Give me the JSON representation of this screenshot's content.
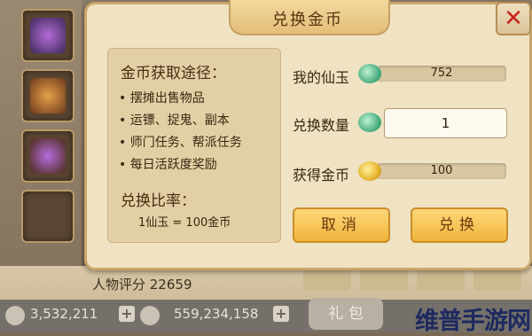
{
  "dialog": {
    "title": "兑换金币",
    "close_icon": "close-x-icon",
    "info": {
      "heading": "金币获取途径：",
      "ways": [
        "• 摆摊出售物品",
        "• 运镖、捉鬼、副本",
        "• 师门任务、帮派任务",
        "• 每日活跃度奖励"
      ],
      "rate_heading": "兑换比率：",
      "rate_value": "1仙玉  =  100金币"
    },
    "my_jade": {
      "label": "我的仙玉",
      "value": "752",
      "icon": "jade-icon"
    },
    "exchange_qty": {
      "label": "兑换数量",
      "value": "1",
      "icon": "jade-icon"
    },
    "gain_gold": {
      "label": "获得金币",
      "value": "100",
      "icon": "gold-coin-icon"
    },
    "cancel_label": "取消",
    "confirm_label": "兑换"
  },
  "background": {
    "rating": "人物评分  22659",
    "currency1": "3,532,211",
    "currency2": "559,234,158",
    "gift_label": "礼 包",
    "watermark": "维普手游网"
  },
  "colors": {
    "title": "#5a3210",
    "close": "#c8241c",
    "button": "#efb43c"
  }
}
